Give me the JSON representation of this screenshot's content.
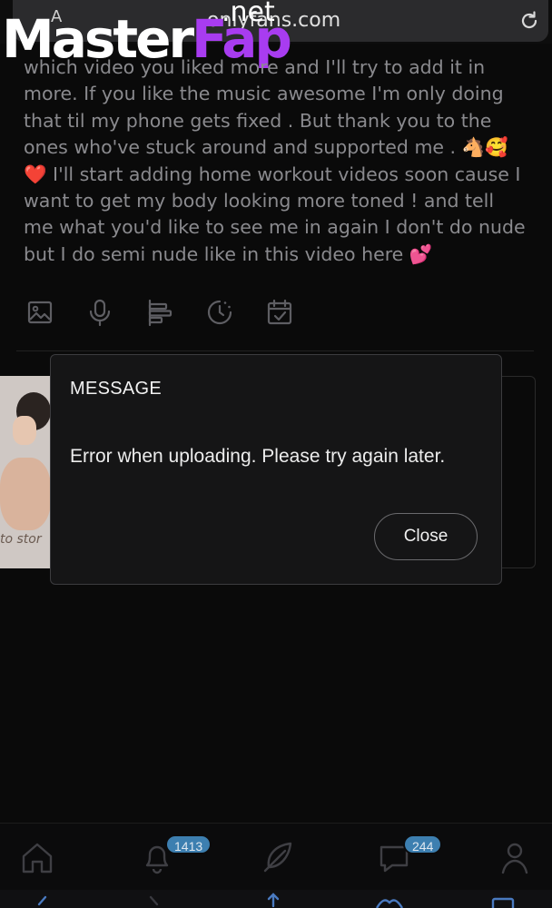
{
  "browser": {
    "aa_label": "A",
    "domain": "onlyfans.com"
  },
  "watermark": {
    "net": ".net",
    "word1": "Master",
    "word2": "Fap"
  },
  "post": {
    "text": "which video you liked more and I'll try to add it in more. If you like the music awesome I'm only doing that til my phone gets fixed . But thank you to the ones who've stuck around and supported me . 🐴🥰 ❤️ I'll start adding home workout videos soon cause I want to get my body looking more toned ! and tell me what you'd like to see me in again I don't do nude but I do semi nude like in this video here 💕"
  },
  "toolbar": {
    "icons": [
      "image-icon",
      "microphone-icon",
      "poll-icon",
      "timer-icon",
      "calendar-icon"
    ]
  },
  "thumbnail": {
    "caption": "to stor"
  },
  "modal": {
    "title": "MESSAGE",
    "message": "Error when uploading. Please try again later.",
    "close_label": "Close"
  },
  "bottom_nav": {
    "notifications_count": "1413",
    "messages_count": "244"
  },
  "colors": {
    "background": "#0a0a0a",
    "accent_badge": "#3d7fb0",
    "watermark_purple": "#a83cf0"
  }
}
